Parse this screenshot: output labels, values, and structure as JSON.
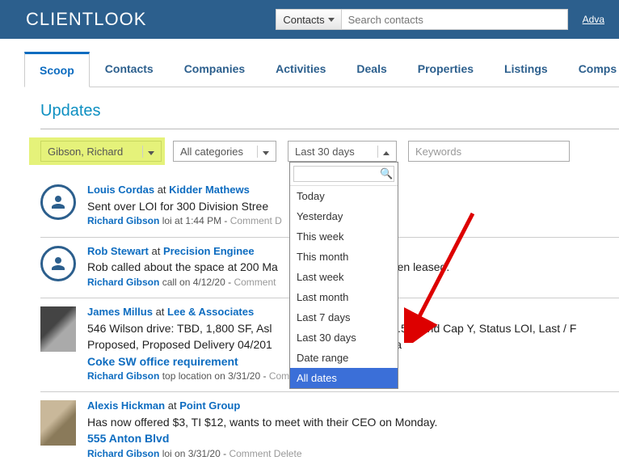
{
  "header": {
    "logo_thin": "CLIENT",
    "logo_bold": "LOOK",
    "search_category": "Contacts",
    "search_placeholder": "Search contacts",
    "advanced": "Adva"
  },
  "tabs": [
    "Scoop",
    "Contacts",
    "Companies",
    "Activities",
    "Deals",
    "Properties",
    "Listings",
    "Comps"
  ],
  "active_tab": 0,
  "page_title": "Updates",
  "filters": {
    "user": "Gibson, Richard",
    "category": "All categories",
    "date": "Last 30 days",
    "keywords_placeholder": "Keywords"
  },
  "date_options": [
    "Today",
    "Yesterday",
    "This week",
    "This month",
    "Last week",
    "Last month",
    "Last 7 days",
    "Last 30 days",
    "Date range",
    "All dates"
  ],
  "date_selected_index": 9,
  "feed": [
    {
      "avatar": "circle",
      "name": "Louis Cordas",
      "at": "at",
      "company": "Kidder Mathews",
      "desc": "Sent over LOI for 300 Division Stree",
      "author": "Richard Gibson",
      "tag": "loi",
      "when": "at 1:44 PM -",
      "actions": "Comment  D"
    },
    {
      "avatar": "circle",
      "name": "Rob Stewart",
      "at": "at",
      "company": "Precision Enginee",
      "desc": "Rob called about the space at 200 Ma",
      "desc_tail": "een leased.",
      "author": "Richard Gibson",
      "tag": "call",
      "when": "on 4/12/20 -",
      "actions": "Comment"
    },
    {
      "avatar": "photo1",
      "name": "James Millus",
      "at": "at",
      "company": "Lee & Associates",
      "desc": "546 Wilson drive: TBD, 1,800 SF, Asl",
      "desc_tail": "$0.50, End Cap Y, Status LOI, Last / F",
      "desc2": "Proposed, Proposed Delivery 04/201",
      "desc2_tail": "era",
      "subline": "Coke SW office requirement",
      "author": "Richard Gibson",
      "tag": "top location",
      "when": "on 3/31/20 -",
      "actions": "Comment  Delete"
    },
    {
      "avatar": "photo2",
      "name": "Alexis Hickman",
      "at": "at",
      "company": "Point Group",
      "desc": "Has now offered $3, TI $12, wants to meet with their CEO on Monday.",
      "subline": "555 Anton Blvd",
      "author": "Richard Gibson",
      "tag": "loi",
      "when": "on 3/31/20 -",
      "actions": "Comment  Delete"
    }
  ]
}
